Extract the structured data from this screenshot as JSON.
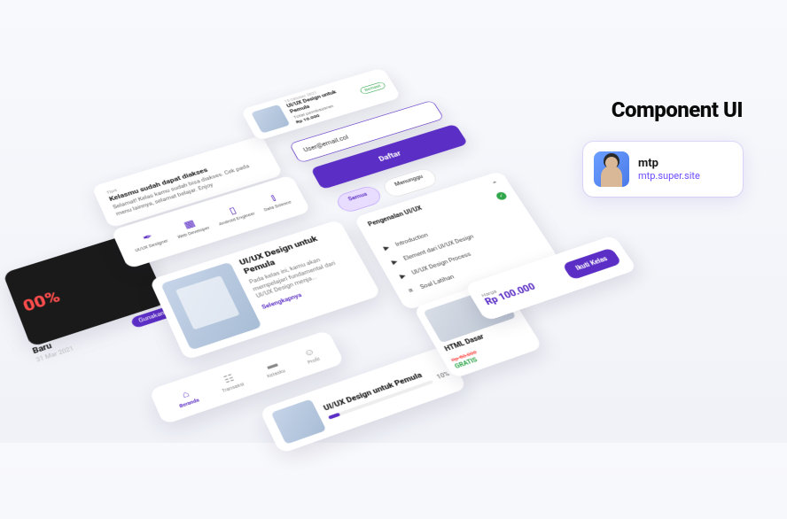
{
  "heading": "Component UI",
  "author": {
    "name": "mtp",
    "link": "mtp.super.site"
  },
  "promo": {
    "percent": "00%",
    "title": "Baru",
    "date": "31 Mar 2021",
    "badge": "Gunakan"
  },
  "notice": {
    "eyebrow": "Tips",
    "title": "Kelasmu sudah dapat diakses",
    "body": "Selamat! Kelas kamu sudah bisa diakses. Cek pada menu lainnya, selamat belajar. Enjoy"
  },
  "iconrow": [
    {
      "glyph": "✒",
      "label": "UI/UX Designer"
    },
    {
      "glyph": "▦",
      "label": "Web Developer"
    },
    {
      "glyph": "▯",
      "label": "Android Engineer"
    },
    {
      "glyph": "⫾",
      "label": "Data Science"
    }
  ],
  "course": {
    "title": "UI/UX Design untuk Pemula",
    "desc": "Pada kelas ini, kamu akan mempelajari fundamental dari UI/UX Design menja...",
    "link": "Selengkapnya"
  },
  "nav": [
    {
      "glyph": "⌂",
      "label": "Beranda",
      "active": true
    },
    {
      "glyph": "☷",
      "label": "Transaksi",
      "active": false
    },
    {
      "glyph": "▬",
      "label": "Kelasku",
      "active": false
    },
    {
      "glyph": "☺",
      "label": "Profil",
      "active": false
    }
  ],
  "progress": {
    "title": "UI/UX Design untuk Pemula",
    "pct": "10%"
  },
  "receipt": {
    "date": "15 Oktober 2021",
    "title": "UI/UX Design untuk Pemula",
    "sub": "Total pembayaran",
    "amount": "Rp 10.000",
    "badge": "Berhasil"
  },
  "email": {
    "value": "User@email.col"
  },
  "register": "Daftar",
  "tabs": {
    "active": "Semua",
    "other": "Menunggu"
  },
  "accordion": {
    "header": "Pengenalan UI/UX",
    "items": [
      {
        "icon": "▶",
        "label": "Introduction"
      },
      {
        "icon": "▶",
        "label": "Element dari UI/UX Design"
      },
      {
        "icon": "▶",
        "label": "UI/UX Design Process"
      },
      {
        "icon": "≡",
        "label": "Soal Latihan"
      }
    ]
  },
  "htmlcard": {
    "title": "HTML Dasar",
    "old": "Rp 50.000",
    "new": "GRATIS"
  },
  "price": {
    "label": "Harga",
    "value": "Rp 100.000",
    "cta": "Ikuti Kelas"
  }
}
